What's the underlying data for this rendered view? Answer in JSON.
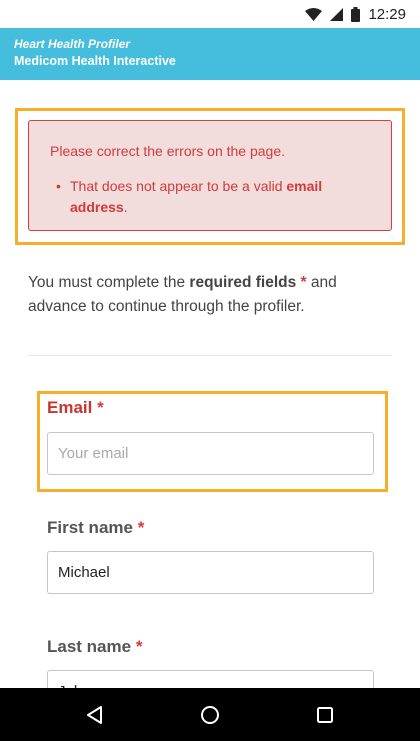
{
  "status_bar": {
    "time": "12:29"
  },
  "app_bar": {
    "title": "Heart Health Profiler",
    "subtitle": "Medicom Health Interactive"
  },
  "error_alert": {
    "heading": "Please correct the errors on the page.",
    "item_text": "That does not appear to be a valid ",
    "item_bold": "email address",
    "item_end": "."
  },
  "intro": {
    "prefix": "You must complete the ",
    "bold": "required fields",
    "star": "*",
    "suffix": " and advance to continue through the profiler."
  },
  "form": {
    "email": {
      "label": "Email",
      "required": "*",
      "value": "",
      "placeholder": "Your email"
    },
    "first_name": {
      "label": "First name",
      "required": "*",
      "value": "Michael"
    },
    "last_name": {
      "label": "Last name",
      "required": "*",
      "value": "Johnson"
    }
  },
  "colors": {
    "app_bar": "#44bedc",
    "error_text": "#cf3c3a",
    "error_bg": "#f3dcdc",
    "highlight": "#f7ae2a"
  },
  "icons": [
    "wifi-icon",
    "cell-signal-icon",
    "battery-icon",
    "back-icon",
    "home-icon",
    "recents-icon"
  ]
}
